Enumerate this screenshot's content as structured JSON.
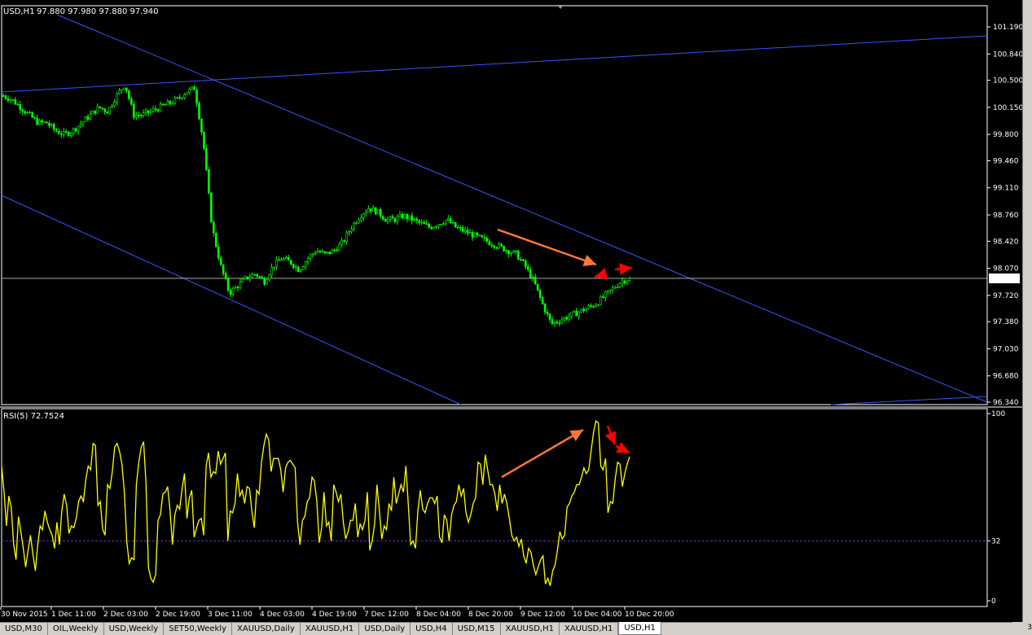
{
  "chart_header": {
    "symbol_label": "USD,H1",
    "ohlc": "97.880 97.980 97.880 97.940"
  },
  "indicator_header": "RSI(5) 72.7524",
  "price_axis": {
    "ticks": [
      "101.190",
      "100.840",
      "100.500",
      "100.150",
      "99.800",
      "99.460",
      "99.110",
      "98.760",
      "98.420",
      "98.070",
      "97.720",
      "97.380",
      "97.030",
      "96.680",
      "96.340"
    ],
    "current_price": "97.940"
  },
  "rsi_axis": {
    "ticks": [
      "100",
      "32",
      "0"
    ],
    "level": 32
  },
  "time_axis": [
    "30 Nov 2015",
    "1 Dec 11:00",
    "2 Dec 03:00",
    "2 Dec 19:00",
    "3 Dec 11:00",
    "4 Dec 03:00",
    "4 Dec 19:00",
    "7 Dec 12:00",
    "8 Dec 04:00",
    "8 Dec 20:00",
    "9 Dec 12:00",
    "10 Dec 04:00",
    "10 Dec 20:00"
  ],
  "tabs": [
    "USD,M30",
    "OIL,Weekly",
    "USD,Weekly",
    "SET50,Weekly",
    "XAUUSD,Daily",
    "XAUUSD,H1",
    "USD,Daily",
    "USD,H4",
    "USD,M15",
    "XAUUSD,H1",
    "XAUUSD,H1",
    "USD,H1"
  ],
  "active_tab": "USD,H1",
  "corner_label": "3",
  "colors": {
    "background": "#000000",
    "candles": "#00ff00",
    "trendlines": "#3355ff",
    "rsi_line": "#ffff00",
    "orange_arrow": "#ff7733",
    "red_arrow": "#ff0000",
    "level_line": "#6633aa"
  },
  "chart_data": [
    {
      "type": "candlestick",
      "symbol": "USD",
      "timeframe": "H1",
      "ylim": [
        96.34,
        101.19
      ],
      "x_ticks": [
        "30 Nov 2015",
        "1 Dec 11:00",
        "2 Dec 03:00",
        "2 Dec 19:00",
        "3 Dec 11:00",
        "4 Dec 03:00",
        "4 Dec 19:00",
        "7 Dec 12:00",
        "8 Dec 04:00",
        "8 Dec 20:00",
        "9 Dec 12:00",
        "10 Dec 04:00",
        "10 Dec 20:00"
      ],
      "close_path": [
        100.3,
        100.25,
        100.15,
        100.05,
        99.95,
        99.95,
        99.85,
        99.8,
        99.85,
        99.95,
        100.05,
        100.15,
        100.1,
        100.3,
        100.45,
        100.05,
        100.05,
        100.1,
        100.15,
        100.2,
        100.25,
        100.35,
        100.4,
        99.7,
        98.6,
        98.1,
        97.75,
        97.85,
        97.95,
        98.0,
        97.9,
        98.1,
        98.2,
        98.15,
        98.05,
        98.2,
        98.3,
        98.25,
        98.3,
        98.4,
        98.6,
        98.75,
        98.85,
        98.8,
        98.7,
        98.7,
        98.75,
        98.7,
        98.65,
        98.6,
        98.65,
        98.7,
        98.6,
        98.55,
        98.5,
        98.45,
        98.4,
        98.35,
        98.3,
        98.25,
        98.1,
        97.9,
        97.6,
        97.35,
        97.4,
        97.45,
        97.5,
        97.55,
        97.6,
        97.7,
        97.8,
        97.9,
        97.94
      ],
      "last_price": 97.94
    },
    {
      "type": "line",
      "name": "RSI(5)",
      "last_value": 72.7524,
      "ylim": [
        0,
        100
      ],
      "level": 32,
      "values": [
        72,
        58,
        40,
        56,
        50,
        30,
        22,
        45,
        37,
        28,
        18,
        27,
        35,
        25,
        16,
        30,
        40,
        38,
        48,
        42,
        38,
        35,
        28,
        42,
        30,
        48,
        57,
        51,
        36,
        40,
        39,
        44,
        53,
        56,
        53,
        65,
        72,
        70,
        84,
        83,
        51,
        53,
        38,
        35,
        62,
        60,
        69,
        82,
        84,
        80,
        73,
        58,
        32,
        20,
        23,
        22,
        62,
        74,
        82,
        85,
        63,
        18,
        12,
        10,
        14,
        43,
        46,
        57,
        58,
        61,
        48,
        30,
        46,
        51,
        49,
        60,
        68,
        44,
        55,
        59,
        34,
        39,
        43,
        44,
        35,
        72,
        79,
        66,
        69,
        68,
        80,
        73,
        76,
        79,
        32,
        48,
        47,
        52,
        68,
        56,
        59,
        52,
        61,
        60,
        48,
        39,
        59,
        57,
        74,
        83,
        89,
        86,
        69,
        76,
        76,
        76,
        70,
        58,
        71,
        74,
        75,
        73,
        71,
        42,
        30,
        43,
        45,
        53,
        55,
        66,
        64,
        53,
        31,
        39,
        58,
        40,
        42,
        32,
        62,
        58,
        53,
        57,
        42,
        33,
        37,
        43,
        43,
        52,
        34,
        41,
        38,
        43,
        58,
        27,
        32,
        41,
        62,
        48,
        33,
        40,
        38,
        52,
        48,
        66,
        52,
        57,
        62,
        58,
        72,
        52,
        30,
        32,
        28,
        48,
        59,
        49,
        47,
        52,
        55,
        55,
        52,
        56,
        34,
        31,
        46,
        43,
        32,
        46,
        51,
        53,
        62,
        56,
        60,
        47,
        42,
        46,
        52,
        55,
        74,
        73,
        62,
        78,
        70,
        62,
        62,
        57,
        48,
        62,
        52,
        57,
        52,
        44,
        35,
        32,
        34,
        29,
        33,
        24,
        20,
        28,
        26,
        19,
        14,
        18,
        22,
        24,
        9,
        12,
        8,
        16,
        19,
        27,
        37,
        33,
        35,
        50,
        52,
        56,
        58,
        62,
        62,
        66,
        71,
        68,
        70,
        80,
        90,
        96,
        95,
        72,
        70,
        76,
        47,
        53,
        52,
        65,
        74,
        73,
        61,
        68,
        73,
        77
      ]
    }
  ]
}
